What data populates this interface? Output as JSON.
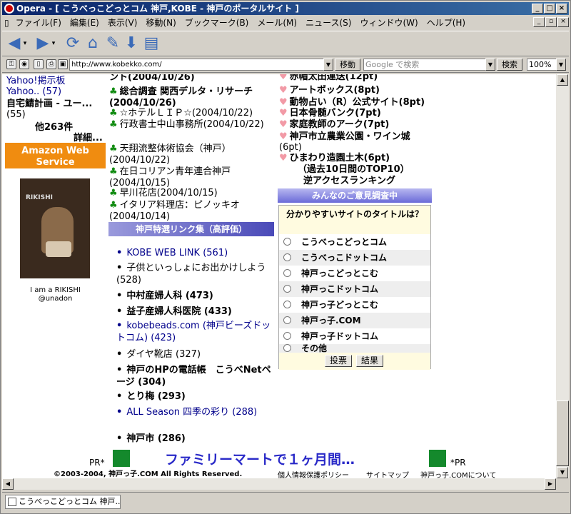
{
  "window": {
    "title": "Opera - [ こうべっこどっとコム 神戸,KOBE - 神戸のポータルサイト ]"
  },
  "menu": [
    "ファイル(F)",
    "編集(E)",
    "表示(V)",
    "移動(N)",
    "ブックマーク(B)",
    "メール(M)",
    "ニュース(S)",
    "ウィンドウ(W)",
    "ヘルプ(H)"
  ],
  "address": {
    "url": "http://www.kobekko.com/",
    "go": "移動",
    "search_placeholder": "Google で検索",
    "search_btn": "検索",
    "zoom": "100%"
  },
  "left": {
    "lines": [
      "Yahoo!掲示板",
      "Yahoo.. (57)",
      "自宅鯖計画 - ユー...",
      "(55)",
      "他263件",
      "詳細..."
    ],
    "amazon": "Amazon Web Service",
    "book_caption1": "I am a RIKISHI",
    "book_caption2": "@unadon",
    "book_cover_text": "RIKISHI"
  },
  "center": {
    "entries": [
      "ント(2004/10/26)",
      "総合調査 関西デルタ・リサーチ(2004/10/26)",
      "☆ホテルＬＩＰ☆(2004/10/22)",
      "行政書士中山事務所(2004/10/22)",
      "天翔流整体術協会（神戸）(2004/10/22)",
      "在日コリアン青年連合神戸(2004/10/15)",
      "早川花店(2004/10/15)",
      "イタリア料理店：ピノッキオ(2004/10/14)"
    ],
    "links_header": "神戸特選リンク集（高評価）",
    "links": [
      "KOBE WEB LINK (561)",
      "子供といっしょにお出かけしよう (528)",
      "中村産婦人科 (473)",
      "益子産婦人科医院 (433)",
      "kobebeads.com (神戸ビーズドットコム) (423)",
      "ダイヤ靴店 (327)",
      "神戸のHPの電話帳　こうべNetページ (304)",
      "とり梅 (293)",
      "ALL Season 四季の彩り (288)",
      "神戸市 (286)"
    ]
  },
  "right": {
    "entries": [
      "赤帽太田運送(12pt)",
      "アートボックス(8pt)",
      "動物占い（R）公式サイト(8pt)",
      "日本骨髄バンク(7pt)",
      "家庭教師のアーク(7pt)",
      "神戸市立農業公園・ワイン城",
      "(6pt)",
      "ひまわり造園土木(6pt)"
    ],
    "ranking1": "（過去10日間のTOP10）",
    "ranking2": "逆アクセスランキング",
    "poll_header": "みんなのご意見調査中",
    "poll_question": "分かりやすいサイトのタイトルは？",
    "options": [
      "こうべっこどっとコム",
      "こうべっこドットコム",
      "神戸っこどっとこむ",
      "神戸っこドットコム",
      "神戸っ子どっとこむ",
      "神戸っ子.COM",
      "神戸っ子ドットコム",
      "その他"
    ],
    "vote": "投票",
    "result": "結果"
  },
  "footer": {
    "pr_left": "PR*",
    "banner": "ファミリーマートで１ヶ月間…",
    "pr_right": "*PR",
    "copyright": "©2003-2004, 神戸っ子.COM  All Rights Reserved.",
    "links": [
      "個人情報保護ポリシー",
      "サイトマップ",
      "神戸っ子.COMについて"
    ]
  },
  "status": {
    "tab": "こうべっこどっとコム 神戸..."
  },
  "colors": {
    "title_start": "#0a246a",
    "section_bar": "#6a6acf",
    "club": "#128c12",
    "heart": "#f29aa6",
    "banner_text": "#2a2ac8",
    "banner_square": "#14892c"
  }
}
